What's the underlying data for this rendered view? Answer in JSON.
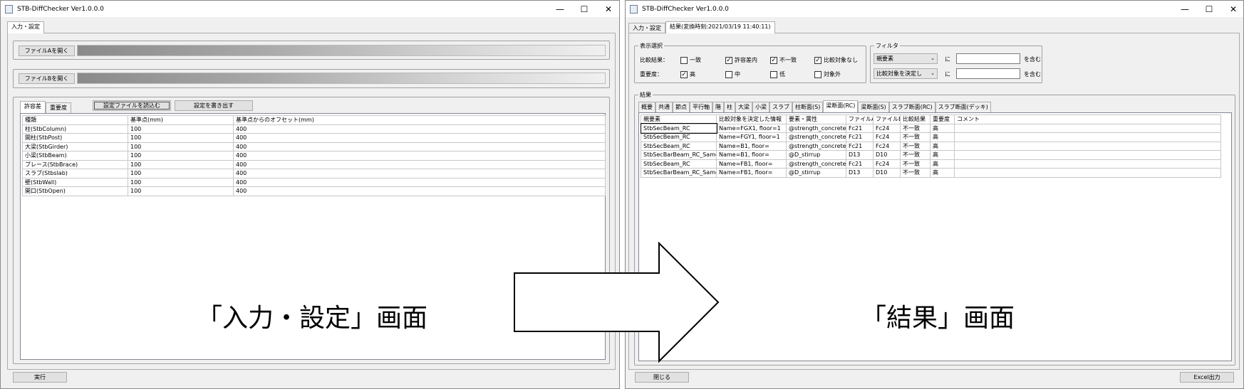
{
  "left": {
    "title": "STB-DiffChecker Ver1.0.0.0",
    "controls": {
      "minimize": "—",
      "maximize": "☐",
      "close": "✕"
    },
    "tabs": [
      "入力・設定"
    ],
    "open_a": "ファイルAを開く",
    "open_b": "ファイルBを開く",
    "inner_tabs": [
      "許容差",
      "重要度"
    ],
    "load_settings": "設定ファイルを読込む",
    "write_settings": "設定を書き出す",
    "table": {
      "headers": [
        "種類",
        "基準点(mm)",
        "基準点からのオフセット(mm)"
      ],
      "rows": [
        [
          "柱(StbColumn)",
          "100",
          "400"
        ],
        [
          "間柱(StbPost)",
          "100",
          "400"
        ],
        [
          "大梁(StbGirder)",
          "100",
          "400"
        ],
        [
          "小梁(StbBeam)",
          "100",
          "400"
        ],
        [
          "ブレース(StbBrace)",
          "100",
          "400"
        ],
        [
          "スラブ(Stbslab)",
          "100",
          "400"
        ],
        [
          "壁(StbWall)",
          "100",
          "400"
        ],
        [
          "開口(StbOpen)",
          "100",
          "400"
        ]
      ]
    },
    "run": "実行"
  },
  "right": {
    "title": "STB-DiffChecker Ver1.0.0.0",
    "controls": {
      "minimize": "—",
      "maximize": "☐",
      "close": "✕"
    },
    "tabs": [
      "入力・設定",
      "結果(変換時刻:2021/03/19 11:40:11)"
    ],
    "display_group": "表示選択",
    "compare_label": "比較結果：",
    "compare_opts": [
      {
        "label": "一致",
        "checked": false
      },
      {
        "label": "許容差内",
        "checked": true
      },
      {
        "label": "不一致",
        "checked": true
      },
      {
        "label": "比較対象なし",
        "checked": true
      }
    ],
    "importance_label": "重要度：",
    "importance_opts": [
      {
        "label": "高",
        "checked": true
      },
      {
        "label": "中",
        "checked": false
      },
      {
        "label": "低",
        "checked": false
      },
      {
        "label": "対象外",
        "checked": false
      }
    ],
    "filter_group": "フィルタ",
    "filter_rows": [
      {
        "combo": "親要素",
        "ni": "に",
        "contains": "を含む"
      },
      {
        "combo": "比較対象を決定し",
        "ni": "に",
        "contains": "を含む"
      }
    ],
    "result_group": "結果",
    "result_tabs": [
      "概要",
      "共通",
      "節点",
      "平行軸",
      "階",
      "柱",
      "大梁",
      "小梁",
      "スラブ",
      "柱断面(S)",
      "梁断面(RC)",
      "梁断面(S)",
      "スラブ断面(RC)",
      "スラブ断面(デッキ)"
    ],
    "selected_result_tab": 10,
    "table": {
      "headers": [
        "親要素",
        "比較対象を決定した情報",
        "要素・属性",
        "ファイルA",
        "ファイルB",
        "比較結果",
        "重要度",
        "コメント"
      ],
      "rows": [
        [
          "StbSecBeam_RC",
          "Name=FGX1,  floor=1",
          "@strength_concrete",
          "Fc21",
          "Fc24",
          "不一致",
          "高",
          ""
        ],
        [
          "StbSecBeam_RC",
          "Name=FGY1,  floor=1",
          "@strength_concrete",
          "Fc21",
          "Fc24",
          "不一致",
          "高",
          ""
        ],
        [
          "StbSecBeam_RC",
          "Name=B1,  floor=",
          "@strength_concrete",
          "Fc21",
          "Fc24",
          "不一致",
          "高",
          ""
        ],
        [
          "StbSecBarBeam_RC_Same",
          "Name=B1,  floor=",
          "@D_stirrup",
          "D13",
          "D10",
          "不一致",
          "高",
          ""
        ],
        [
          "StbSecBeam_RC",
          "Name=FB1,  floor=",
          "@strength_concrete",
          "Fc21",
          "Fc24",
          "不一致",
          "高",
          ""
        ],
        [
          "StbSecBarBeam_RC_Same",
          "Name=FB1,  floor=",
          "@D_stirrup",
          "D13",
          "D10",
          "不一致",
          "高",
          ""
        ]
      ]
    },
    "close": "閉じる",
    "excel": "Excel出力"
  },
  "captions": {
    "left": "「入力・設定」画面",
    "right": "「結果」画面"
  }
}
